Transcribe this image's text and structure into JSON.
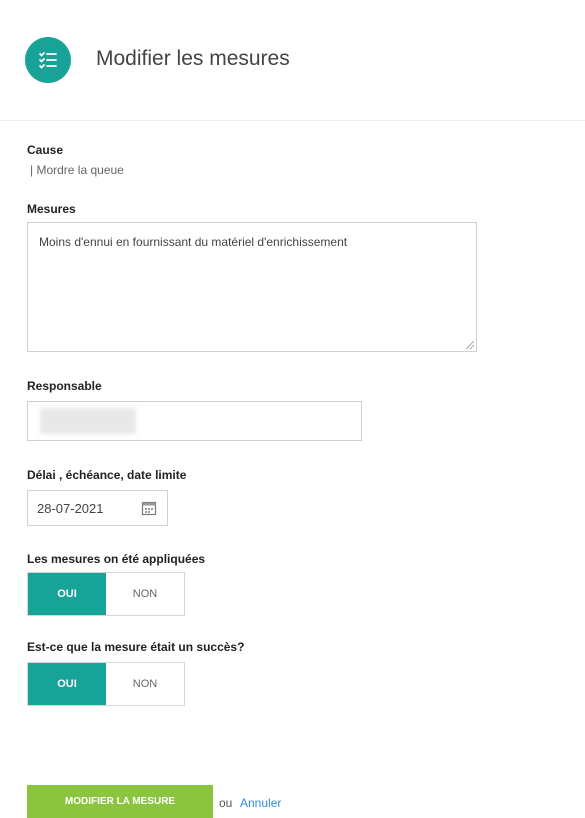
{
  "header": {
    "title": "Modifier les mesures",
    "icon": "list-icon",
    "icon_color": "#18a398"
  },
  "cause": {
    "label": "Cause",
    "value": "| Mordre la queue"
  },
  "mesures": {
    "label": "Mesures",
    "value": "Moins d'ennui en fournissant du matériel d'enrichissement"
  },
  "responsable": {
    "label": "Responsable",
    "value": ""
  },
  "deadline": {
    "label": "Délai , échéance, date limite",
    "value": "28-07-2021",
    "icon": "calendar-icon"
  },
  "applied": {
    "label": "Les mesures on été appliquées",
    "yes": "OUI",
    "no": "NON",
    "selected": "OUI"
  },
  "success": {
    "label": "Est-ce que la mesure était un succès?",
    "yes": "OUI",
    "no": "NON",
    "selected": "OUI"
  },
  "actions": {
    "submit": "MODIFIER LA MESURE",
    "or": "ou",
    "cancel": "Annuler",
    "submit_color": "#8bc43f",
    "link_color": "#2d8fe0"
  }
}
